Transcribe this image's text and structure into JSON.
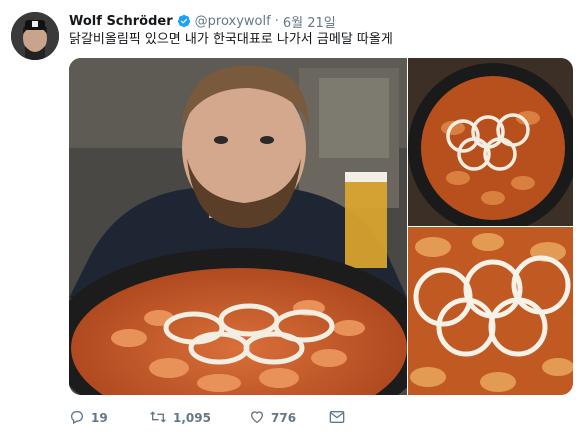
{
  "tweet": {
    "author_name": "Wolf Schröder",
    "handle": "@proxywolf",
    "separator": "·",
    "date": "6월 21일",
    "text": "닭갈비올림픽 있으면 내가 한국대표로 나가서 금메달 따올게",
    "verified_icon": "verified-badge-icon",
    "avatar_icon": "profile-avatar"
  },
  "actions": {
    "reply_count": "19",
    "retweet_count": "1,095",
    "like_count": "776"
  },
  "colors": {
    "text": "#14171a",
    "secondary": "#657786",
    "verified": "#1da1f2",
    "sauce": "#c4521f",
    "pan": "#1c1c1c"
  }
}
